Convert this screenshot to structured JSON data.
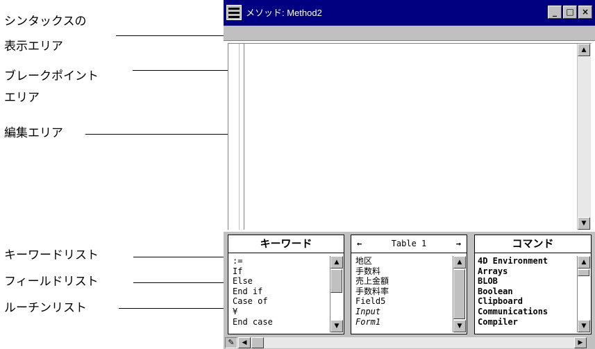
{
  "callouts": {
    "syntax_area_line1": "シンタックスの",
    "syntax_area_line2": "表示エリア",
    "breakpoint_area_line1": "ブレークポイント",
    "breakpoint_area_line2": "エリア",
    "edit_area": "編集エリア",
    "keyword_list": "キーワードリスト",
    "field_list": "フィールドリスト",
    "routine_list": "ルーチンリスト"
  },
  "window": {
    "title": "メソッド: Method2",
    "minimize": "_",
    "maximize": "□",
    "close": "×"
  },
  "keyword_list": {
    "header": "キーワード",
    "items": [
      ":=",
      "If",
      "Else",
      "End if",
      "Case of",
      "¥",
      "End case"
    ]
  },
  "field_list": {
    "table_name": "Table 1",
    "prev_arrow": "←",
    "next_arrow": "→",
    "items": [
      "地区",
      "手数料",
      "売上金額",
      "手数料率",
      "Field5",
      "Input",
      "Form1"
    ]
  },
  "command_list": {
    "header": "コマンド",
    "items": [
      "4D Environment",
      "Arrays",
      "BLOB",
      "Boolean",
      "Clipboard",
      "Communications",
      "Compiler"
    ]
  },
  "icons": {
    "scroll_up": "▲",
    "scroll_down": "▼",
    "scroll_left": "◀",
    "scroll_right": "▶",
    "pencil": "✎"
  }
}
